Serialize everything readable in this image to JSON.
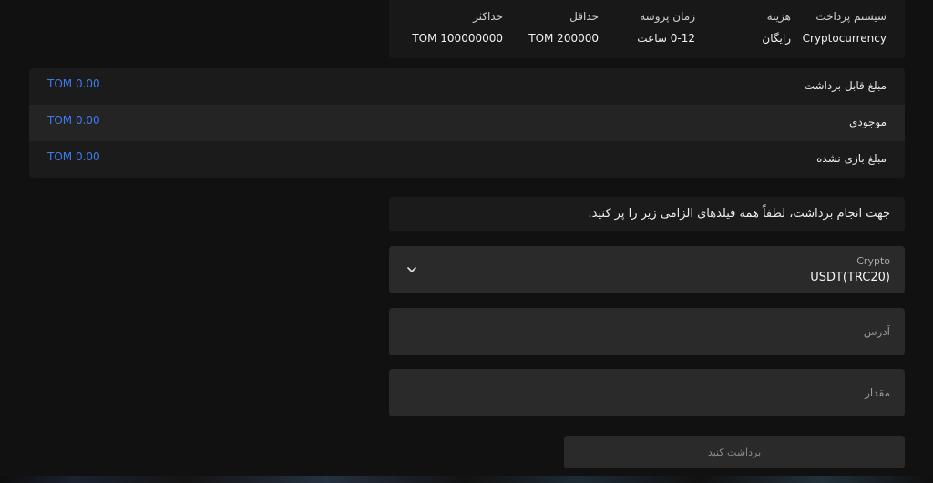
{
  "payment": {
    "columns": [
      {
        "header": "سیستم پرداخت",
        "value": "Cryptocurrency"
      },
      {
        "header": "هزینه",
        "value": "رایگان"
      },
      {
        "header": "زمان پروسه",
        "value": "0-12 ساعت"
      },
      {
        "header": "حداقل",
        "value": "TOM 200000"
      },
      {
        "header": "حداکثر",
        "value": "TOM 100000000"
      }
    ]
  },
  "balance": {
    "rows": [
      {
        "label": "مبلغ قابل برداشت",
        "value": "TOM 0.00"
      },
      {
        "label": "موجودی",
        "value": "TOM 0.00"
      },
      {
        "label": "مبلغ بازی نشده",
        "value": "TOM 0.00"
      }
    ],
    "value_color": "#3b7bf0"
  },
  "form": {
    "instruction": "جهت انجام برداشت، لطفاً همه فیلدهای الزامی زیر را پر کنید.",
    "crypto_select": {
      "label": "Crypto",
      "value": "USDT(TRC20)",
      "icon": "chevron-down-icon"
    },
    "address": {
      "placeholder": "آدرس",
      "value": ""
    },
    "amount": {
      "placeholder": "مقدار",
      "value": ""
    },
    "submit_label": "برداشت کنید"
  }
}
